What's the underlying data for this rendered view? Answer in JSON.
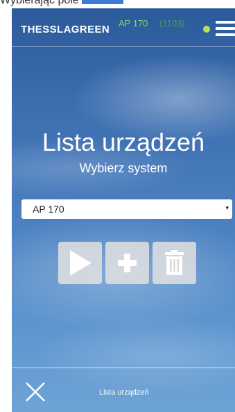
{
  "document": {
    "caption_text": "Wybierając pole"
  },
  "header": {
    "brand": "THESSLAGREEN",
    "device_model": "AP 170",
    "device_serial": "(1103)",
    "status_dot_color": "#b8e05c",
    "menu_icon": "hamburger-menu-icon"
  },
  "main": {
    "title": "Lista urządzeń",
    "subtitle": "Wybierz system",
    "system_select": {
      "selected": "AP 170",
      "caret": "▾"
    },
    "actions": [
      {
        "name": "play",
        "icon": "play-icon"
      },
      {
        "name": "add",
        "icon": "plus-icon"
      },
      {
        "name": "delete",
        "icon": "trash-icon"
      }
    ]
  },
  "footer": {
    "close_icon": "close-icon",
    "label": "Lista urządzeń"
  },
  "colors": {
    "accent_green": "#6fe05a",
    "button_bg": "#e1e1e1",
    "sky_top": "#2b5a9a",
    "sky_bottom": "#6ea3d6"
  }
}
